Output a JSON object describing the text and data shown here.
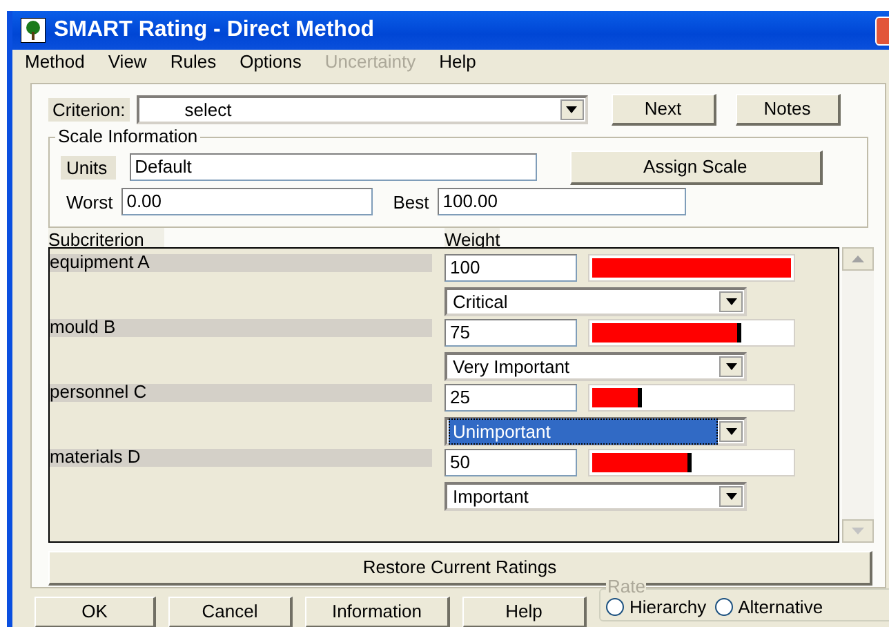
{
  "window": {
    "title": "SMART Rating - Direct Method"
  },
  "menu": [
    {
      "label": "Method",
      "disabled": false
    },
    {
      "label": "View",
      "disabled": false
    },
    {
      "label": "Rules",
      "disabled": false
    },
    {
      "label": "Options",
      "disabled": false
    },
    {
      "label": "Uncertainty",
      "disabled": true
    },
    {
      "label": "Help",
      "disabled": false
    }
  ],
  "criterion": {
    "label": "Criterion:",
    "value": "select"
  },
  "top_buttons": [
    "Next",
    "Notes"
  ],
  "scale": {
    "title": "Scale Information",
    "units_label": "Units",
    "units": "Default",
    "assign_button": "Assign Scale",
    "worst_label": "Worst",
    "worst": "0.00",
    "best_label": "Best",
    "best": "100.00"
  },
  "columns": [
    "Subcriterion",
    "Weight"
  ],
  "subcriteria": [
    {
      "name": "equipment A",
      "weight": "100",
      "level": 1.0,
      "rating": "Critical",
      "selected": false
    },
    {
      "name": "mould B",
      "weight": "75",
      "level": 0.75,
      "rating": "Very Important",
      "selected": false
    },
    {
      "name": "personnel C",
      "weight": "25",
      "level": 0.25,
      "rating": "Unimportant",
      "selected": true
    },
    {
      "name": "materials D",
      "weight": "50",
      "level": 0.5,
      "rating": "Important",
      "selected": false
    }
  ],
  "restore_button": "Restore Current Ratings",
  "bottom_buttons": [
    "OK",
    "Cancel",
    "Information",
    "Help"
  ],
  "rate": {
    "title": "Rate",
    "disabled": true,
    "options": [
      {
        "label": "Hierarchy",
        "selected": false
      },
      {
        "label": "Alternative",
        "selected": false
      }
    ]
  }
}
